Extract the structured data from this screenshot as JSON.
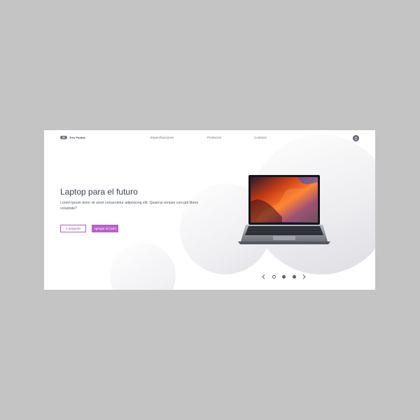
{
  "brand": {
    "name": "Tres Puntos",
    "icon": "brand-logo-icon"
  },
  "nav": {
    "links": [
      "Especificaciones",
      "Productos",
      "Contacto"
    ],
    "cart_icon": "shopping-bag-icon"
  },
  "hero": {
    "title": "Laptop para el futuro",
    "description": "Lorem ipsum dolor sit amet consectetur adipisicing elit. Quaerat veniam corrupti libero voluptate?",
    "buttons": {
      "secondary": "Ir pulgadas",
      "primary": "Agregar al Carro"
    }
  },
  "slider": {
    "prev_icon": "chevron-left-icon",
    "next_icon": "chevron-right-icon",
    "dot_count": 3,
    "active_index": 0
  },
  "colors": {
    "accent": "#b862c9",
    "text_dark": "#3d4352",
    "text_muted": "#6d7180",
    "page_bg": "#ffffff",
    "outer_bg": "#c4c4c4"
  }
}
